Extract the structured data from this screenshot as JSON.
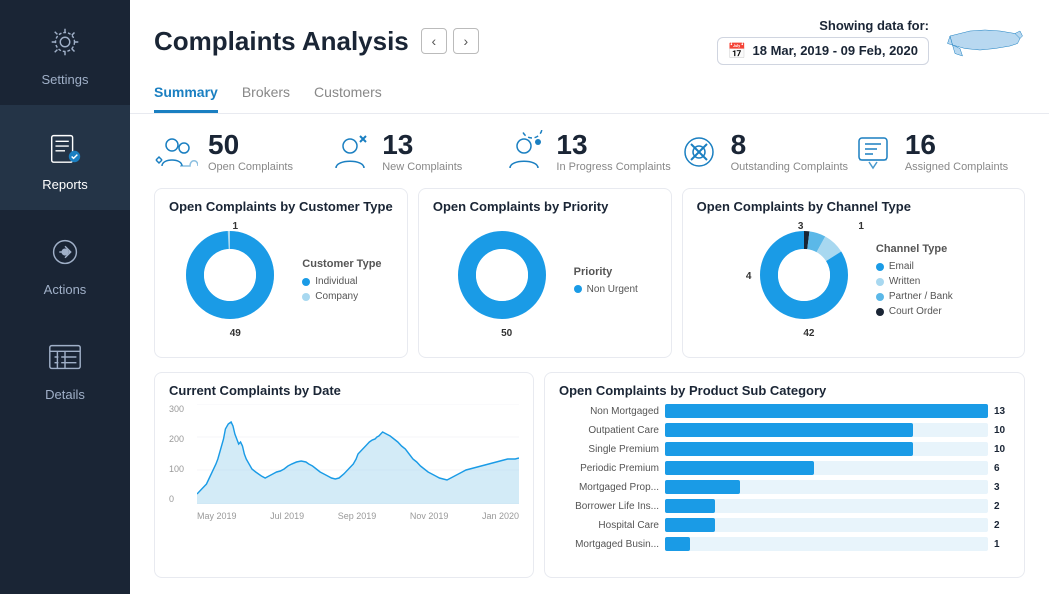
{
  "sidebar": {
    "items": [
      {
        "label": "Settings",
        "icon": "settings-icon",
        "active": false
      },
      {
        "label": "Reports",
        "icon": "reports-icon",
        "active": true
      },
      {
        "label": "Actions",
        "icon": "actions-icon",
        "active": false
      },
      {
        "label": "Details",
        "icon": "details-icon",
        "active": false
      }
    ]
  },
  "header": {
    "title": "Complaints Analysis",
    "tabs": [
      "Summary",
      "Brokers",
      "Customers"
    ],
    "active_tab": "Summary",
    "showing_label": "Showing data for:",
    "date_range": "18 Mar, 2019 - 09 Feb, 2020"
  },
  "stats": [
    {
      "number": "50",
      "label": "Open Complaints"
    },
    {
      "number": "13",
      "label": "New Complaints"
    },
    {
      "number": "13",
      "label": "In Progress Complaints"
    },
    {
      "number": "8",
      "label": "Outstanding Complaints"
    },
    {
      "number": "16",
      "label": "Assigned Complaints"
    }
  ],
  "donut_customer": {
    "title": "Open Complaints by Customer Type",
    "legend_title": "Customer Type",
    "segments": [
      {
        "label": "Individual",
        "value": 49,
        "color": "#1a9be6",
        "pct": 98
      },
      {
        "label": "Company",
        "value": 1,
        "color": "#a8d8f0",
        "pct": 2
      }
    ],
    "label_top": "1",
    "label_bottom": "49"
  },
  "donut_priority": {
    "title": "Open Complaints by Priority",
    "legend_title": "Priority",
    "segments": [
      {
        "label": "Non Urgent",
        "value": 50,
        "color": "#1a9be6",
        "pct": 100
      }
    ],
    "label_bottom": "50"
  },
  "donut_channel": {
    "title": "Open Complaints by Channel Type",
    "legend_title": "Channel Type",
    "segments": [
      {
        "label": "Email",
        "value": 42,
        "color": "#1a9be6",
        "pct": 84
      },
      {
        "label": "Written",
        "value": 4,
        "color": "#a8d8f0",
        "pct": 8
      },
      {
        "label": "Partner / Bank",
        "value": 3,
        "color": "#5bb8e8",
        "pct": 6
      },
      {
        "label": "Court Order",
        "value": 1,
        "color": "#1a2535",
        "pct": 2
      }
    ],
    "label_top_left": "3",
    "label_top_right": "1",
    "label_left": "4",
    "label_bottom": "42"
  },
  "line_chart": {
    "title": "Current Complaints by Date",
    "y_labels": [
      "300",
      "200",
      "100",
      "0"
    ],
    "x_labels": [
      "May 2019",
      "Jul 2019",
      "Sep 2019",
      "Nov 2019",
      "Jan 2020"
    ]
  },
  "bar_chart": {
    "title": "Open Complaints by Product Sub Category",
    "items": [
      {
        "label": "Non Mortgaged",
        "value": 13,
        "max": 13
      },
      {
        "label": "Outpatient Care",
        "value": 10,
        "max": 13
      },
      {
        "label": "Single Premium",
        "value": 10,
        "max": 13
      },
      {
        "label": "Periodic Premium",
        "value": 6,
        "max": 13
      },
      {
        "label": "Mortgaged Prop...",
        "value": 3,
        "max": 13
      },
      {
        "label": "Borrower Life Ins...",
        "value": 2,
        "max": 13
      },
      {
        "label": "Hospital Care",
        "value": 2,
        "max": 13
      },
      {
        "label": "Mortgaged Busin...",
        "value": 1,
        "max": 13
      }
    ]
  }
}
